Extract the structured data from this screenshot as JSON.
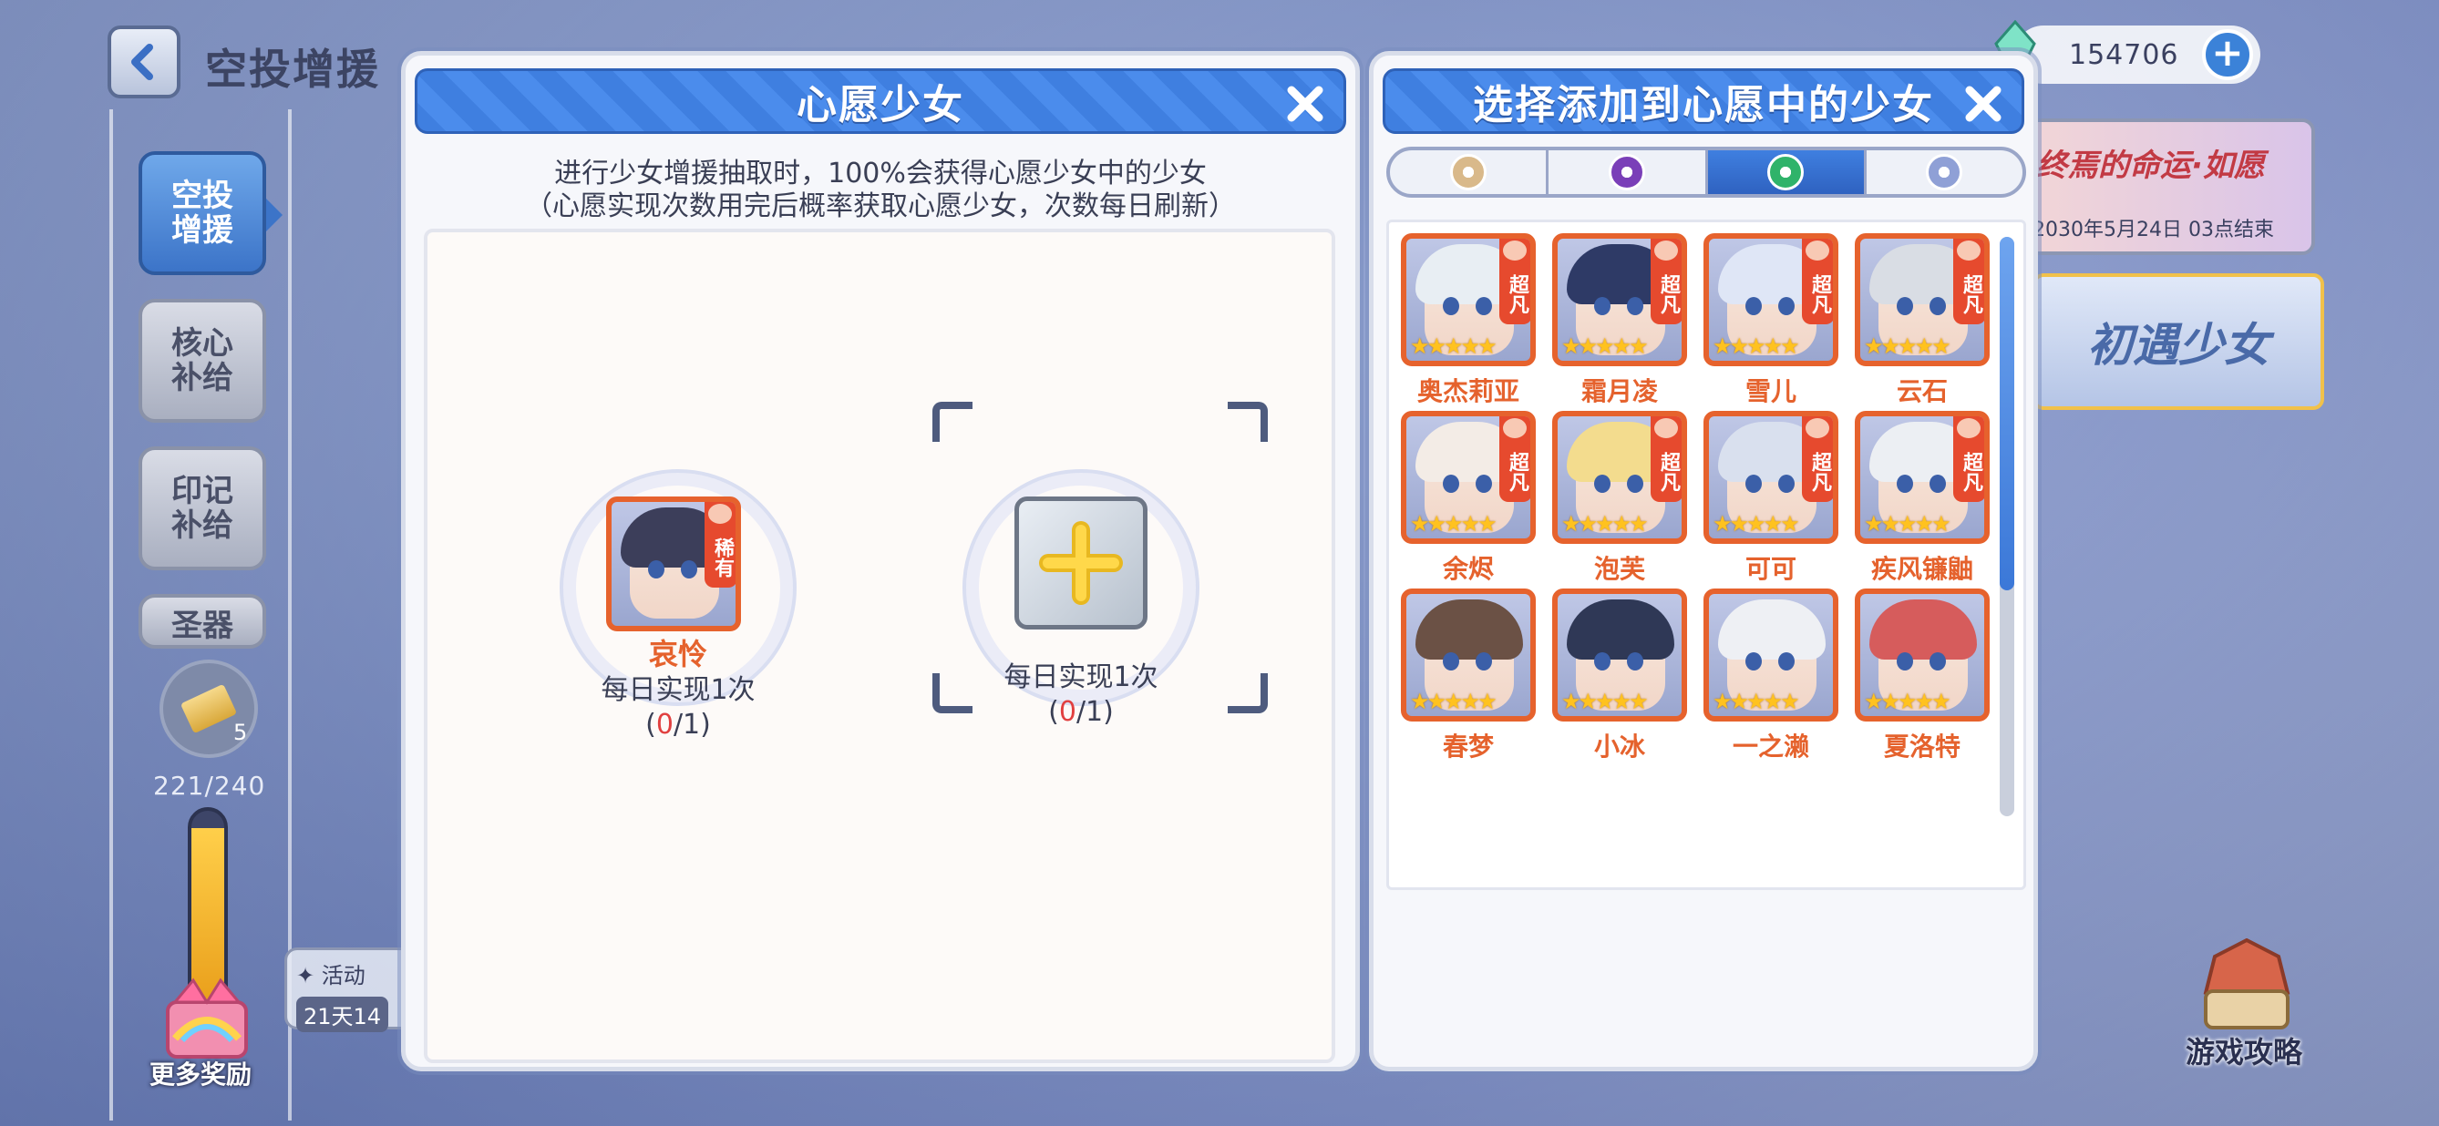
{
  "top": {
    "title": "空投增援",
    "currency_value": "154706",
    "currency_plus": "+"
  },
  "sidebar": {
    "tabs": [
      {
        "label": "空投增援",
        "active": true
      },
      {
        "label": "核心补给",
        "active": false
      },
      {
        "label": "印记补给",
        "active": false
      },
      {
        "label": "圣器",
        "active": false
      }
    ],
    "ticket_count": "5",
    "energy_text": "221/240",
    "energy_fraction": 0.92,
    "more_reward": "更多奖励",
    "activity_label": "活动",
    "activity_time": "21天14"
  },
  "banner": {
    "title": "终焉的命运·如愿",
    "date": "2030年5月24日 03点结束"
  },
  "meet_button": "初遇少女",
  "guide_label": "游戏攻略",
  "wish_panel": {
    "title": "心愿少女",
    "desc_line1": "进行少女增援抽取时，100%会获得心愿少女中的少女",
    "desc_line2": "（心愿实现次数用完后概率获取心愿少女，次数每日刷新）",
    "slots": [
      {
        "name": "哀怜",
        "rarity": "稀有",
        "info": "每日实现1次",
        "count_open": "(",
        "count_cur": "0",
        "count_rest": "/1)",
        "hair": "#3c3e5a"
      },
      {
        "name": "",
        "info": "每日实现1次",
        "count_open": "(",
        "count_cur": "0",
        "count_rest": "/1)"
      }
    ]
  },
  "select_panel": {
    "title": "选择添加到心愿中的少女",
    "filters": [
      {
        "icon": "light-element-icon",
        "color": "#d9b98a",
        "active": false
      },
      {
        "icon": "dark-element-icon",
        "color": "#7a3fb8",
        "active": false
      },
      {
        "icon": "nature-element-icon",
        "color": "#2fb36a",
        "active": true
      },
      {
        "icon": "gear-element-icon",
        "color": "#8fa0d6",
        "active": false
      }
    ],
    "girls": [
      {
        "name": "奥杰莉亚",
        "rarity": "超凡",
        "hair": "#e8eef3"
      },
      {
        "name": "霜月凌",
        "rarity": "超凡",
        "hair": "#2e3a66"
      },
      {
        "name": "雪儿",
        "rarity": "超凡",
        "hair": "#dfe6f6"
      },
      {
        "name": "云石",
        "rarity": "超凡",
        "hair": "#d9dde4"
      },
      {
        "name": "余烬",
        "rarity": "超凡",
        "hair": "#f3ece6"
      },
      {
        "name": "泡芙",
        "rarity": "超凡",
        "hair": "#f3dc8e"
      },
      {
        "name": "可可",
        "rarity": "超凡",
        "hair": "#d9e0ee"
      },
      {
        "name": "疾风镰鼬",
        "rarity": "超凡",
        "hair": "#eceff3"
      },
      {
        "name": "春梦",
        "rarity": "",
        "hair": "#6b5145"
      },
      {
        "name": "小冰",
        "rarity": "",
        "hair": "#2f3856"
      },
      {
        "name": "一之濑",
        "rarity": "",
        "hair": "#eef0f4"
      },
      {
        "name": "夏洛特",
        "rarity": "",
        "hair": "#d65c5c"
      }
    ],
    "star_text": "★★★★★",
    "scroll_fraction": 0.61
  }
}
